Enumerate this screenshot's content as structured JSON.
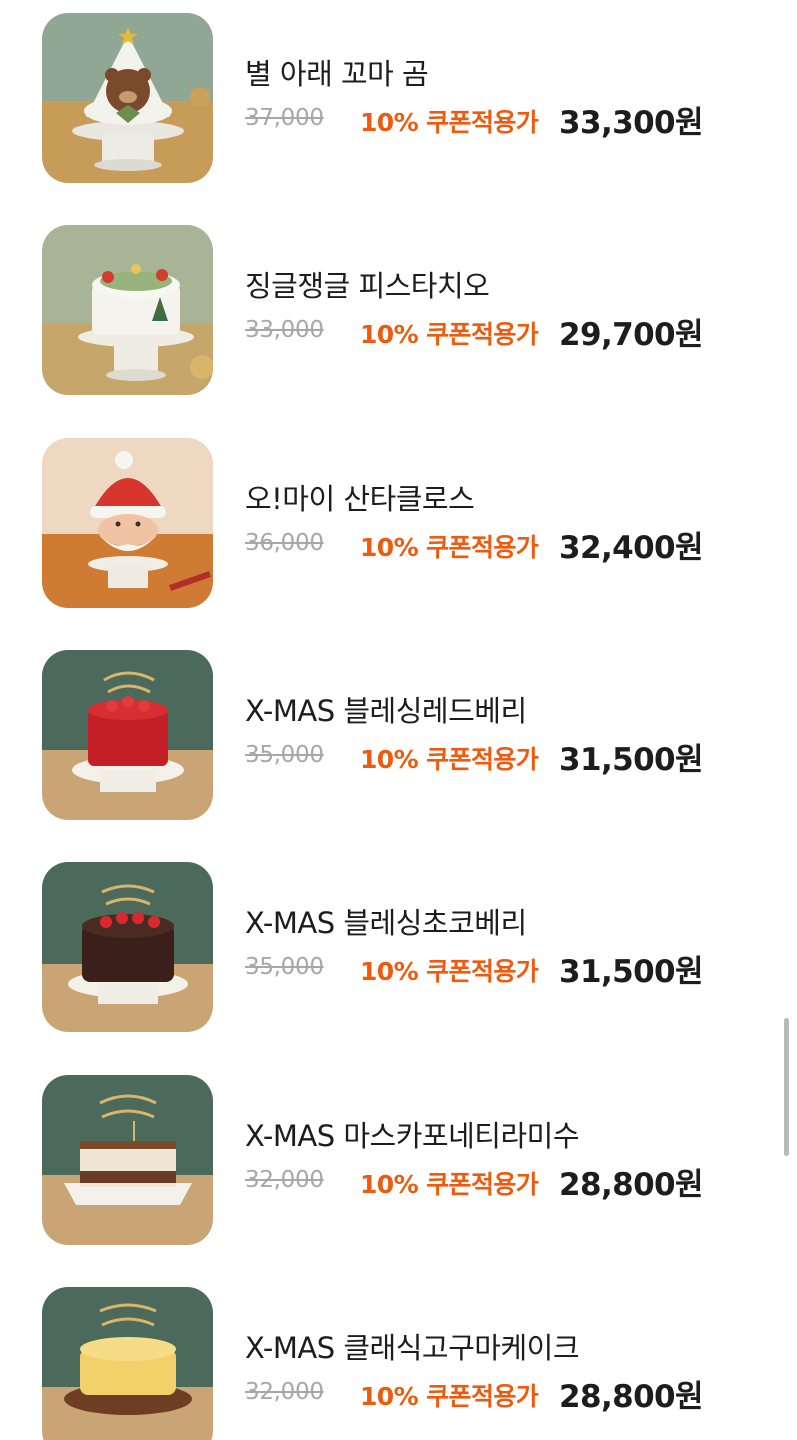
{
  "products": [
    {
      "name": "별 아래 꼬마 곰",
      "original_price": "37,000",
      "coupon_label": "10% 쿠폰적용가",
      "final_price": "33,300원",
      "image": "bear-christmas-tree-cake",
      "bg_color": "#b89a63"
    },
    {
      "name": "징글쟁글 피스타치오",
      "original_price": "33,000",
      "coupon_label": "10% 쿠폰적용가",
      "final_price": "29,700원",
      "image": "pistachio-wreath-cake",
      "bg_color": "#b8a06a"
    },
    {
      "name": "오!마이 산타클로스",
      "original_price": "36,000",
      "coupon_label": "10% 쿠폰적용가",
      "final_price": "32,400원",
      "image": "santa-claus-cake",
      "bg_color": "#c8782f"
    },
    {
      "name": "X-MAS 블레싱레드베리",
      "original_price": "35,000",
      "coupon_label": "10% 쿠폰적용가",
      "final_price": "31,500원",
      "image": "red-berry-cake",
      "bg_color": "#4e6b5c"
    },
    {
      "name": "X-MAS 블레싱초코베리",
      "original_price": "35,000",
      "coupon_label": "10% 쿠폰적용가",
      "final_price": "31,500원",
      "image": "choco-berry-cake",
      "bg_color": "#4e6b5c"
    },
    {
      "name": "X-MAS 마스카포네티라미수",
      "original_price": "32,000",
      "coupon_label": "10% 쿠폰적용가",
      "final_price": "28,800원",
      "image": "mascarpone-tiramisu-cake",
      "bg_color": "#4e6b5c"
    },
    {
      "name": "X-MAS 클래식고구마케이크",
      "original_price": "32,000",
      "coupon_label": "10% 쿠폰적용가",
      "final_price": "28,800원",
      "image": "sweet-potato-cake",
      "bg_color": "#4e6b5c"
    }
  ],
  "colors": {
    "coupon": "#ee5a0e",
    "price": "#1d1d1d",
    "strikethrough": "#a7a7a7"
  }
}
